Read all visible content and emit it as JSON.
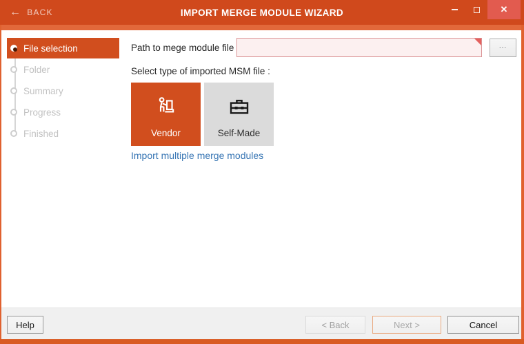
{
  "window": {
    "back_label": "BACK",
    "title": "IMPORT MERGE MODULE WIZARD"
  },
  "icons": {
    "back": "←",
    "minimize": "minimize-dash",
    "maximize": "maximize-square",
    "close": "✕",
    "vendor": "hand-truck-person",
    "self_made": "toolbox",
    "error": "red-corner-triangle"
  },
  "colors": {
    "accent_orange": "#D14E1E",
    "titlebar_orange": "#D0491C",
    "band_orange": "#E2683A",
    "close_red": "#E25B4F",
    "link_blue": "#3876B4",
    "error_field_bg": "#FCF0F0",
    "error_field_border": "#DA9294"
  },
  "sidebar": {
    "steps": [
      {
        "label": "File selection",
        "state": "active"
      },
      {
        "label": "Folder",
        "state": "pending"
      },
      {
        "label": "Summary",
        "state": "pending"
      },
      {
        "label": "Progress",
        "state": "pending"
      },
      {
        "label": "Finished",
        "state": "pending"
      }
    ]
  },
  "main": {
    "path_label": "Path to mege module file",
    "path_value": "",
    "browse_label": "...",
    "type_label": "Select type of imported MSM file :",
    "tiles": [
      {
        "label": "Vendor",
        "selected": true
      },
      {
        "label": "Self-Made",
        "selected": false
      }
    ],
    "link_label": "Import multiple merge modules"
  },
  "footer": {
    "help_label": "Help",
    "back_label": "< Back",
    "next_label": "Next >",
    "cancel_label": "Cancel"
  }
}
